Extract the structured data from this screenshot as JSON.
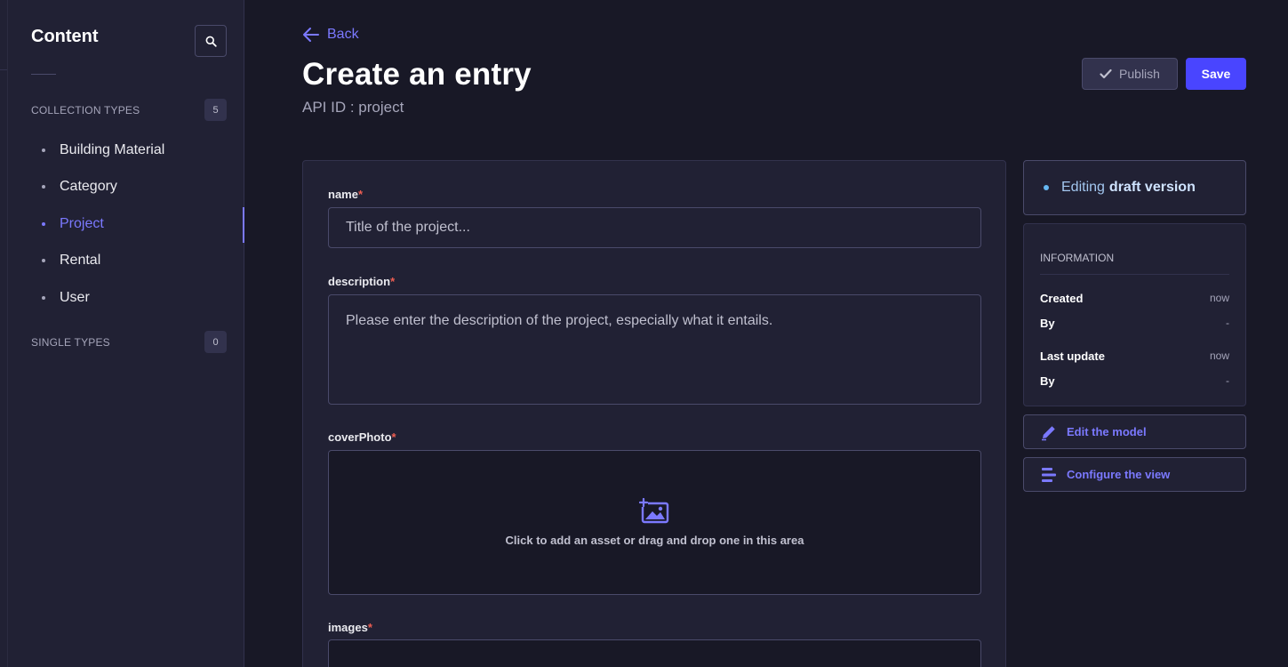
{
  "sidebar": {
    "title": "Content",
    "collection_types": {
      "label": "COLLECTION TYPES",
      "count": "5"
    },
    "items": [
      {
        "label": "Building Material",
        "active": false
      },
      {
        "label": "Category",
        "active": false
      },
      {
        "label": "Project",
        "active": true
      },
      {
        "label": "Rental",
        "active": false
      },
      {
        "label": "User",
        "active": false
      }
    ],
    "single_types": {
      "label": "SINGLE TYPES",
      "count": "0"
    }
  },
  "header": {
    "back_label": "Back",
    "title": "Create an entry",
    "subtitle": "API ID : project",
    "publish_label": "Publish",
    "save_label": "Save"
  },
  "form": {
    "name": {
      "label": "name",
      "placeholder": "Title of the project..."
    },
    "description": {
      "label": "description",
      "placeholder": "Please enter the description of the project, especially what it entails."
    },
    "coverPhoto": {
      "label": "coverPhoto",
      "dropzone_text": "Click to add an asset or drag and drop one in this area"
    },
    "images": {
      "label": "images"
    }
  },
  "status": {
    "prefix": "Editing",
    "bold": "draft version"
  },
  "information": {
    "title": "INFORMATION",
    "created_label": "Created",
    "created_value": "now",
    "created_by_label": "By",
    "created_by_value": "-",
    "updated_label": "Last update",
    "updated_value": "now",
    "updated_by_label": "By",
    "updated_by_value": "-"
  },
  "actions": {
    "edit_model": "Edit the model",
    "configure_view": "Configure the view"
  },
  "colors": {
    "accent": "#7b79ff",
    "primary": "#4945ff",
    "background": "#181826",
    "surface": "#212134",
    "required": "#ee5e52"
  }
}
